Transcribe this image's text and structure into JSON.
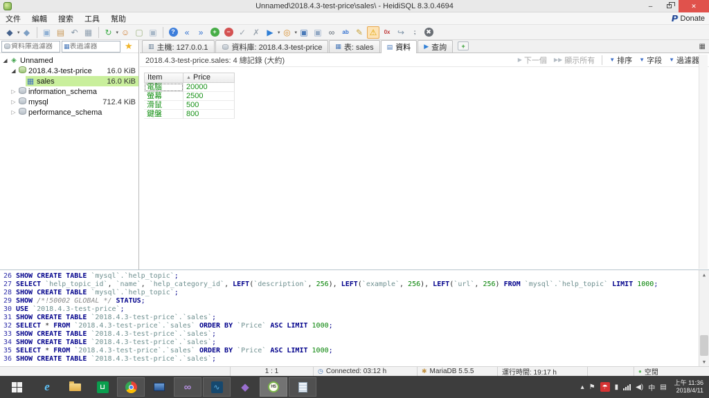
{
  "window": {
    "title": "Unnamed\\2018.4.3-test-price\\sales\\ - HeidiSQL 8.3.0.4694",
    "minimize": "–",
    "close": "✕"
  },
  "menu": {
    "items": [
      "文件",
      "編輯",
      "搜索",
      "工具",
      "幫助"
    ],
    "paypal_glyph": "P",
    "donate_label": "Donate"
  },
  "toolbar": {
    "icons": [
      {
        "n": "connect-icon",
        "g": "◆",
        "c": "#44618c",
        "dd": true
      },
      {
        "n": "disconnect-icon",
        "g": "◆",
        "c": "#7d9fc4"
      },
      {
        "n": "copy-icon",
        "g": "▣",
        "c": "#8fb0d4",
        "sep": true
      },
      {
        "n": "paste-icon",
        "g": "▤",
        "c": "#c89858"
      },
      {
        "n": "undo-icon",
        "g": "↶",
        "c": "#8898a8"
      },
      {
        "n": "print-icon",
        "g": "▦",
        "c": "#90a0b0"
      },
      {
        "n": "refresh-icon",
        "g": "↻",
        "c": "#3fae49",
        "dd": true,
        "sep": true
      },
      {
        "n": "user-manager-icon",
        "g": "☺",
        "c": "#d08038"
      },
      {
        "n": "new-file-icon",
        "g": "▢",
        "c": "#9ab07c"
      },
      {
        "n": "copy-file-icon",
        "g": "▣",
        "c": "#a8b8c8"
      },
      {
        "n": "help-icon",
        "g": "?",
        "c": "#ffffff",
        "bg": "#3d7edb",
        "sep": true
      },
      {
        "n": "first-record-icon",
        "g": "«",
        "c": "#2f6fd0"
      },
      {
        "n": "last-record-icon",
        "g": "»",
        "c": "#2f6fd0"
      },
      {
        "n": "add-record-icon",
        "g": "+",
        "c": "#ffffff",
        "bg": "#47ad47"
      },
      {
        "n": "delete-record-icon",
        "g": "−",
        "c": "#ffffff",
        "bg": "#d45252"
      },
      {
        "n": "post-record-icon",
        "g": "✓",
        "c": "#9aa4ae"
      },
      {
        "n": "cancel-edit-icon",
        "g": "✗",
        "c": "#9aa4ae"
      },
      {
        "n": "execute-icon",
        "g": "▶",
        "c": "#2f7fd6",
        "dd": true
      },
      {
        "n": "find-icon",
        "g": "◎",
        "c": "#d88f2e",
        "dd": true
      },
      {
        "n": "save-icon",
        "g": "▣",
        "c": "#4a7ab8"
      },
      {
        "n": "save-as-icon",
        "g": "▣",
        "c": "#93a9c4"
      },
      {
        "n": "binoculars-icon",
        "g": "∞",
        "c": "#5a6570"
      },
      {
        "n": "letters-case-icon",
        "g": "ab",
        "c": "#2f6fd0",
        "txt": true
      },
      {
        "n": "edit-icon",
        "g": "✎",
        "c": "#c8a238"
      },
      {
        "n": "warning-filter-icon",
        "g": "⚠",
        "c": "#e0a400",
        "sel": true
      },
      {
        "n": "hex-view-icon",
        "g": "0x",
        "c": "#c03a3a",
        "txt": true
      },
      {
        "n": "foreign-key-icon",
        "g": "↪",
        "c": "#7f93a8"
      },
      {
        "n": "semicolon-icon",
        "g": ";",
        "c": "#3a4a5a",
        "txt": true
      },
      {
        "n": "stop-icon",
        "g": "✖",
        "c": "#ffffff",
        "bg": "#6a6f75"
      }
    ]
  },
  "sidebar": {
    "database_filter_placeholder": "資料庫過濾器",
    "table_filter_placeholder": "表過濾器",
    "tree": [
      {
        "label": "Unnamed",
        "size": "",
        "level": 0,
        "arrow": "exp",
        "icon": "session",
        "selected": false
      },
      {
        "label": "2018.4.3-test-price",
        "size": "16.0 KiB",
        "level": 1,
        "arrow": "exp",
        "icon": "db-green",
        "selected": false
      },
      {
        "label": "sales",
        "size": "16.0 KiB",
        "level": 2,
        "arrow": "",
        "icon": "table",
        "selected": true
      },
      {
        "label": "information_schema",
        "size": "",
        "level": 1,
        "arrow": "col",
        "icon": "db",
        "selected": false
      },
      {
        "label": "mysql",
        "size": "712.4 KiB",
        "level": 1,
        "arrow": "col",
        "icon": "db",
        "selected": false
      },
      {
        "label": "performance_schema",
        "size": "",
        "level": 1,
        "arrow": "col",
        "icon": "db",
        "selected": false
      }
    ]
  },
  "tabs": {
    "items": [
      {
        "label": "主機: 127.0.0.1",
        "icon": "host",
        "active": false
      },
      {
        "label": "資料庫: 2018.4.3-test-price",
        "icon": "db",
        "active": false
      },
      {
        "label": "表: sales",
        "icon": "table",
        "active": false
      },
      {
        "label": "資料",
        "icon": "data",
        "active": true
      },
      {
        "label": "查詢",
        "icon": "query",
        "active": false
      }
    ],
    "new_tab_glyph": "+",
    "tab_list_glyph": "▦"
  },
  "data_panel": {
    "summary": "2018.4.3-test-price.sales: 4 總記錄 (大約)",
    "actions": [
      {
        "label": "下一個",
        "icon": "▶",
        "disabled": true,
        "sep_after": false
      },
      {
        "label": "顯示所有",
        "icon": "▶▶",
        "disabled": true,
        "sep_after": true
      },
      {
        "label": "排序",
        "icon": "▼",
        "disabled": false,
        "sep_after": false
      },
      {
        "label": "字段",
        "icon": "▼",
        "disabled": false,
        "sep_after": false
      },
      {
        "label": "過濾器",
        "icon": "▼",
        "disabled": false,
        "sep_after": false
      }
    ],
    "grid": {
      "columns": [
        {
          "label": "Item",
          "sorted": ""
        },
        {
          "label": "Price",
          "sorted": "asc"
        }
      ],
      "rows": [
        [
          "電腦",
          "20000"
        ],
        [
          "螢幕",
          "2500"
        ],
        [
          "滑鼠",
          "500"
        ],
        [
          "鍵盤",
          "800"
        ]
      ]
    }
  },
  "sql_log": {
    "lines": [
      {
        "num": "26",
        "tokens": [
          [
            "SHOW CREATE TABLE ",
            "kw"
          ],
          [
            "`mysql`.`help_topic`",
            "id"
          ],
          [
            ";",
            "pun"
          ]
        ]
      },
      {
        "num": "27",
        "tokens": [
          [
            "SELECT ",
            "kw"
          ],
          [
            "`help_topic_id`",
            "id"
          ],
          [
            ", ",
            "txt"
          ],
          [
            "`name`",
            "id"
          ],
          [
            ", ",
            "txt"
          ],
          [
            "`help_category_id`",
            "id"
          ],
          [
            ",  ",
            "txt"
          ],
          [
            "LEFT",
            "kw"
          ],
          [
            "(",
            "txt"
          ],
          [
            "`description`",
            "id"
          ],
          [
            ", ",
            "txt"
          ],
          [
            "256",
            "lit"
          ],
          [
            "),  ",
            "txt"
          ],
          [
            "LEFT",
            "kw"
          ],
          [
            "(",
            "txt"
          ],
          [
            "`example`",
            "id"
          ],
          [
            ", ",
            "txt"
          ],
          [
            "256",
            "lit"
          ],
          [
            "),  ",
            "txt"
          ],
          [
            "LEFT",
            "kw"
          ],
          [
            "(",
            "txt"
          ],
          [
            "`url`",
            "id"
          ],
          [
            ", ",
            "txt"
          ],
          [
            "256",
            "lit"
          ],
          [
            ") ",
            "txt"
          ],
          [
            "FROM ",
            "kw"
          ],
          [
            "`mysql`.`help_topic`",
            "id"
          ],
          [
            " ",
            "txt"
          ],
          [
            "LIMIT ",
            "kw"
          ],
          [
            "1000",
            "lit"
          ],
          [
            ";",
            "pun"
          ]
        ]
      },
      {
        "num": "28",
        "tokens": [
          [
            "SHOW CREATE TABLE ",
            "kw"
          ],
          [
            "`mysql`.`help_topic`",
            "id"
          ],
          [
            ";",
            "pun"
          ]
        ]
      },
      {
        "num": "29",
        "tokens": [
          [
            "SHOW ",
            "kw"
          ],
          [
            "/*!50002 GLOBAL */",
            "cmt"
          ],
          [
            " ",
            "txt"
          ],
          [
            "STATUS",
            "kw"
          ],
          [
            ";",
            "pun"
          ]
        ]
      },
      {
        "num": "30",
        "tokens": [
          [
            "USE ",
            "kw"
          ],
          [
            "`2018.4.3-test-price`",
            "id"
          ],
          [
            ";",
            "pun"
          ]
        ]
      },
      {
        "num": "31",
        "tokens": [
          [
            "SHOW CREATE TABLE ",
            "kw"
          ],
          [
            "`2018.4.3-test-price`.`sales`",
            "id"
          ],
          [
            ";",
            "pun"
          ]
        ]
      },
      {
        "num": "32",
        "tokens": [
          [
            "SELECT",
            "kw"
          ],
          [
            " * ",
            "txt"
          ],
          [
            "FROM ",
            "kw"
          ],
          [
            "`2018.4.3-test-price`.`sales`",
            "id"
          ],
          [
            " ",
            "txt"
          ],
          [
            "ORDER BY ",
            "kw"
          ],
          [
            "`Price`",
            "id"
          ],
          [
            " ",
            "txt"
          ],
          [
            "ASC LIMIT ",
            "kw"
          ],
          [
            "1000",
            "lit"
          ],
          [
            ";",
            "pun"
          ]
        ]
      },
      {
        "num": "33",
        "tokens": [
          [
            "SHOW CREATE TABLE ",
            "kw"
          ],
          [
            "`2018.4.3-test-price`.`sales`",
            "id"
          ],
          [
            ";",
            "pun"
          ]
        ]
      },
      {
        "num": "34",
        "tokens": [
          [
            "SHOW CREATE TABLE ",
            "kw"
          ],
          [
            "`2018.4.3-test-price`.`sales`",
            "id"
          ],
          [
            ";",
            "pun"
          ]
        ]
      },
      {
        "num": "35",
        "tokens": [
          [
            "SELECT",
            "kw"
          ],
          [
            " * ",
            "txt"
          ],
          [
            "FROM ",
            "kw"
          ],
          [
            "`2018.4.3-test-price`.`sales`",
            "id"
          ],
          [
            " ",
            "txt"
          ],
          [
            "ORDER BY ",
            "kw"
          ],
          [
            "`Price`",
            "id"
          ],
          [
            " ",
            "txt"
          ],
          [
            "ASC LIMIT ",
            "kw"
          ],
          [
            "1000",
            "lit"
          ],
          [
            ";",
            "pun"
          ]
        ]
      },
      {
        "num": "36",
        "tokens": [
          [
            "SHOW CREATE TABLE ",
            "kw"
          ],
          [
            "`2018.4.3-test-price`.`sales`",
            "id"
          ],
          [
            ";",
            "pun"
          ]
        ]
      }
    ]
  },
  "status_bar": {
    "segments": [
      {
        "text": "",
        "icon": ""
      },
      {
        "text": "1 : 1",
        "icon": ""
      },
      {
        "text": "Connected: 03:12 h",
        "icon": "clock"
      },
      {
        "text": "MariaDB 5.5.5",
        "icon": "seal"
      },
      {
        "text": "運行時間: 19:17 h",
        "icon": ""
      },
      {
        "text": "",
        "icon": ""
      },
      {
        "text": "空閒",
        "icon": "dot"
      }
    ]
  },
  "taskbar": {
    "items": [
      {
        "n": "start-button",
        "kind": "start",
        "open": false,
        "active": false
      },
      {
        "n": "internet-explorer-icon",
        "kind": "ie",
        "g": "e",
        "open": false,
        "active": false
      },
      {
        "n": "file-explorer-icon",
        "kind": "folder",
        "open": false,
        "active": false
      },
      {
        "n": "windows-store-icon",
        "kind": "store",
        "g": "⊔",
        "open": false,
        "active": false
      },
      {
        "n": "chrome-icon",
        "kind": "chrome",
        "open": true,
        "active": false
      },
      {
        "n": "remote-desktop-icon",
        "kind": "monitor",
        "open": false,
        "active": false
      },
      {
        "n": "visual-studio-icon",
        "kind": "vs",
        "g": "∞",
        "c": "#b48ede",
        "open": true,
        "active": false
      },
      {
        "n": "mysql-workbench-icon",
        "kind": "wb",
        "g": "∿",
        "open": true,
        "active": false
      },
      {
        "n": "vs-purple-icon",
        "kind": "vs",
        "g": "◆",
        "c": "#9a6fd0",
        "open": false,
        "active": false
      },
      {
        "n": "heidisql-taskbar-icon",
        "kind": "hs",
        "label": "HS",
        "open": true,
        "active": true
      },
      {
        "n": "notepad-icon",
        "kind": "page",
        "open": true,
        "active": false
      }
    ],
    "tray": [
      {
        "n": "tray-expand-icon",
        "kind": "glyph",
        "g": "▴"
      },
      {
        "n": "tray-flag-icon",
        "kind": "glyph",
        "g": "⚑"
      },
      {
        "n": "avira-icon",
        "kind": "avira",
        "g": "☂"
      },
      {
        "n": "battery-icon",
        "kind": "glyph",
        "g": "▮"
      },
      {
        "n": "network-signal-icon",
        "kind": "signal"
      },
      {
        "n": "volume-icon",
        "kind": "glyph",
        "g": "◀)"
      },
      {
        "n": "ime-chinese-icon",
        "kind": "glyph",
        "g": "中"
      },
      {
        "n": "action-center-icon",
        "kind": "glyph",
        "g": "▤"
      }
    ],
    "clock": {
      "time": "上午 11:36",
      "date": "2018/4/11"
    }
  }
}
